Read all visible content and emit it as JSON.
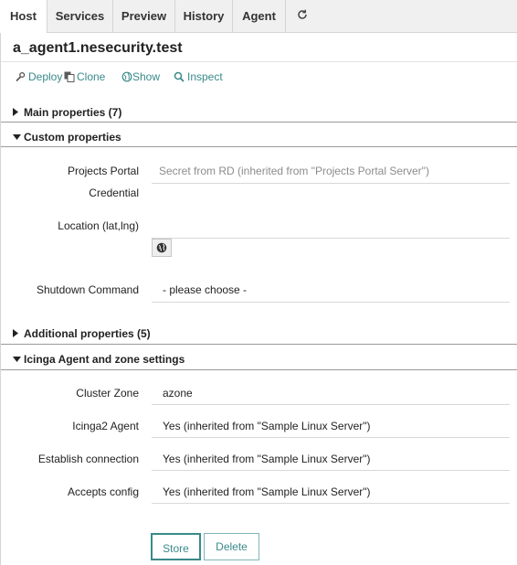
{
  "tabs": [
    {
      "label": "Host",
      "active": true
    },
    {
      "label": "Services",
      "active": false
    },
    {
      "label": "Preview",
      "active": false
    },
    {
      "label": "History",
      "active": false
    },
    {
      "label": "Agent",
      "active": false
    }
  ],
  "host": {
    "title": "a_agent1.nesecurity.test"
  },
  "actions": {
    "deploy": "Deploy",
    "clone": "Clone",
    "show": "Show",
    "inspect": "Inspect"
  },
  "sections": {
    "main": "Main properties (7)",
    "custom": "Custom properties",
    "additional": "Additional properties (5)",
    "agent": "Icinga Agent and zone settings"
  },
  "custom_fields": {
    "projects_portal_label_line1": "Projects Portal",
    "projects_portal_label_line2": "Credential",
    "projects_portal_value": "Secret from RD  (inherited from \"Projects Portal Server\")",
    "location_label": "Location (lat,lng)",
    "location_value": "",
    "shutdown_label": "Shutdown Command",
    "shutdown_value": "- please choose -"
  },
  "agent_fields": [
    {
      "label": "Cluster Zone",
      "value": "azone"
    },
    {
      "label": "Icinga2 Agent",
      "value": "Yes (inherited from \"Sample Linux Server\")"
    },
    {
      "label": "Establish connection",
      "value": "Yes (inherited from \"Sample Linux Server\")"
    },
    {
      "label": "Accepts config",
      "value": "Yes (inherited from \"Sample Linux Server\")"
    }
  ],
  "buttons": {
    "store": "Store",
    "delete": "Delete"
  },
  "colors": {
    "accent": "#3a8a8a",
    "tabbar": "#f0f0f0",
    "border": "#d5d5d5"
  }
}
